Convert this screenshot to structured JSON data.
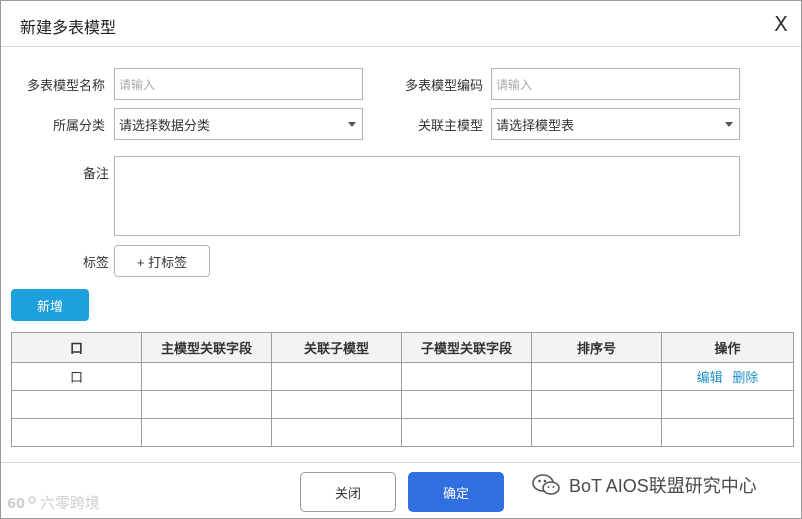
{
  "dialog": {
    "title": "新建多表模型",
    "close_glyph": "X"
  },
  "form": {
    "name_label": "多表模型名称",
    "name_placeholder": "请输入",
    "code_label": "多表模型编码",
    "code_placeholder": "请输入",
    "category_label": "所属分类",
    "category_value": "请选择数据分类",
    "main_model_label": "关联主模型",
    "main_model_value": "请选择模型表",
    "remark_label": "备注",
    "tag_label": "标签",
    "tag_button": "+ 打标签"
  },
  "toolbar": {
    "add_label": "新增"
  },
  "table": {
    "headers": [
      "口",
      "主模型关联字段",
      "关联子模型",
      "子模型关联字段",
      "排序号",
      "操作"
    ],
    "rows": [
      {
        "check": "口",
        "main_field": "",
        "sub_model": "",
        "sub_field": "",
        "sort": "",
        "edit": "编辑",
        "delete": "删除"
      },
      {
        "check": "",
        "main_field": "",
        "sub_model": "",
        "sub_field": "",
        "sort": "",
        "edit": "",
        "delete": ""
      },
      {
        "check": "",
        "main_field": "",
        "sub_model": "",
        "sub_field": "",
        "sort": "",
        "edit": "",
        "delete": ""
      }
    ]
  },
  "footer": {
    "close_label": "关闭",
    "ok_label": "确定"
  },
  "watermarks": {
    "left": "六零跨境",
    "right": "BoT AIOS联盟研究中心"
  },
  "colors": {
    "primary": "#1ea0dc",
    "confirm": "#2f6fe0",
    "link": "#1e90c9"
  },
  "icons": {
    "close": "close-icon",
    "caret": "chevron-down-icon",
    "wechat": "wechat-icon"
  }
}
